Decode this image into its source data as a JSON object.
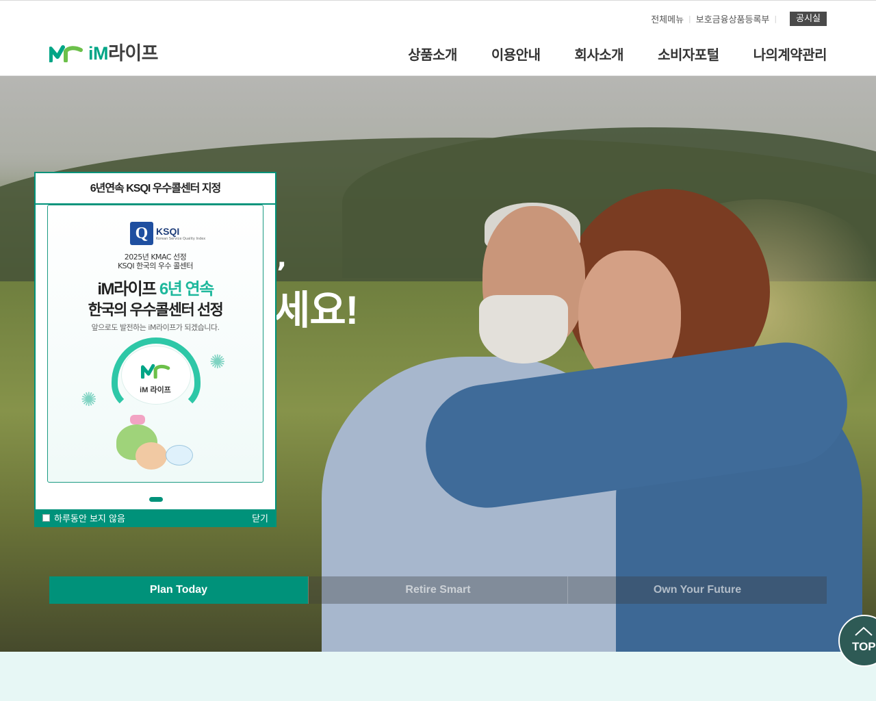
{
  "header": {
    "util_links": [
      "전체메뉴",
      "보호금융상품등록부"
    ],
    "util_button": "공시실",
    "logo_text": "라이프",
    "logo_im": "iM",
    "nav": [
      "상품소개",
      "이용안내",
      "회사소개",
      "소비자포털",
      "나의계약관리"
    ]
  },
  "hero": {
    "headline": "세요!",
    "headline_mark": "’",
    "tabs": [
      "Plan Today",
      "Retire Smart",
      "Own Your Future"
    ],
    "active_tab": 0,
    "top_button": "TOP"
  },
  "popup": {
    "title": "6년연속 KSQI 우수콜센터 지정",
    "ksqi_label": "KSQI",
    "ksqi_sub": "Korean Service Quality Index",
    "line1": "2025년 KMAC 선정",
    "line2": "KSQI 한국의 우수 콜센터",
    "head1_a": "iM라이프 ",
    "head1_b": "6년 연속",
    "head2": "한국의 우수콜센터 선정",
    "sub": "앞으로도 발전하는 iM라이프가 되겠습니다.",
    "badge_text": "iM 라이프",
    "dont_show": "하루동안 보지 않음",
    "close": "닫기"
  },
  "colors": {
    "brand": "#00927a",
    "brand_light": "#1eb89c",
    "util_button_bg": "#4a4a4a"
  },
  "icons": [
    "im-logo-icon",
    "checkbox-icon",
    "chevron-up-icon"
  ]
}
